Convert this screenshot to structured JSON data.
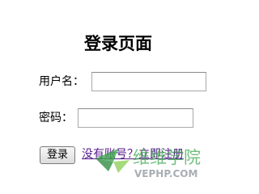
{
  "page": {
    "title": "登录页面"
  },
  "form": {
    "username_label": "用户名：",
    "username_value": "",
    "password_label": "密码：",
    "password_value": "",
    "login_button": "登录",
    "register_prefix": "没有账号？",
    "register_link": "立即注册"
  },
  "watermark": {
    "name": "维维学院",
    "site": "VEPHP.COM"
  },
  "colors": {
    "link": "#551a8b",
    "watermark_green": "#3aa64a",
    "watermark_gray": "#9aa0a6"
  }
}
